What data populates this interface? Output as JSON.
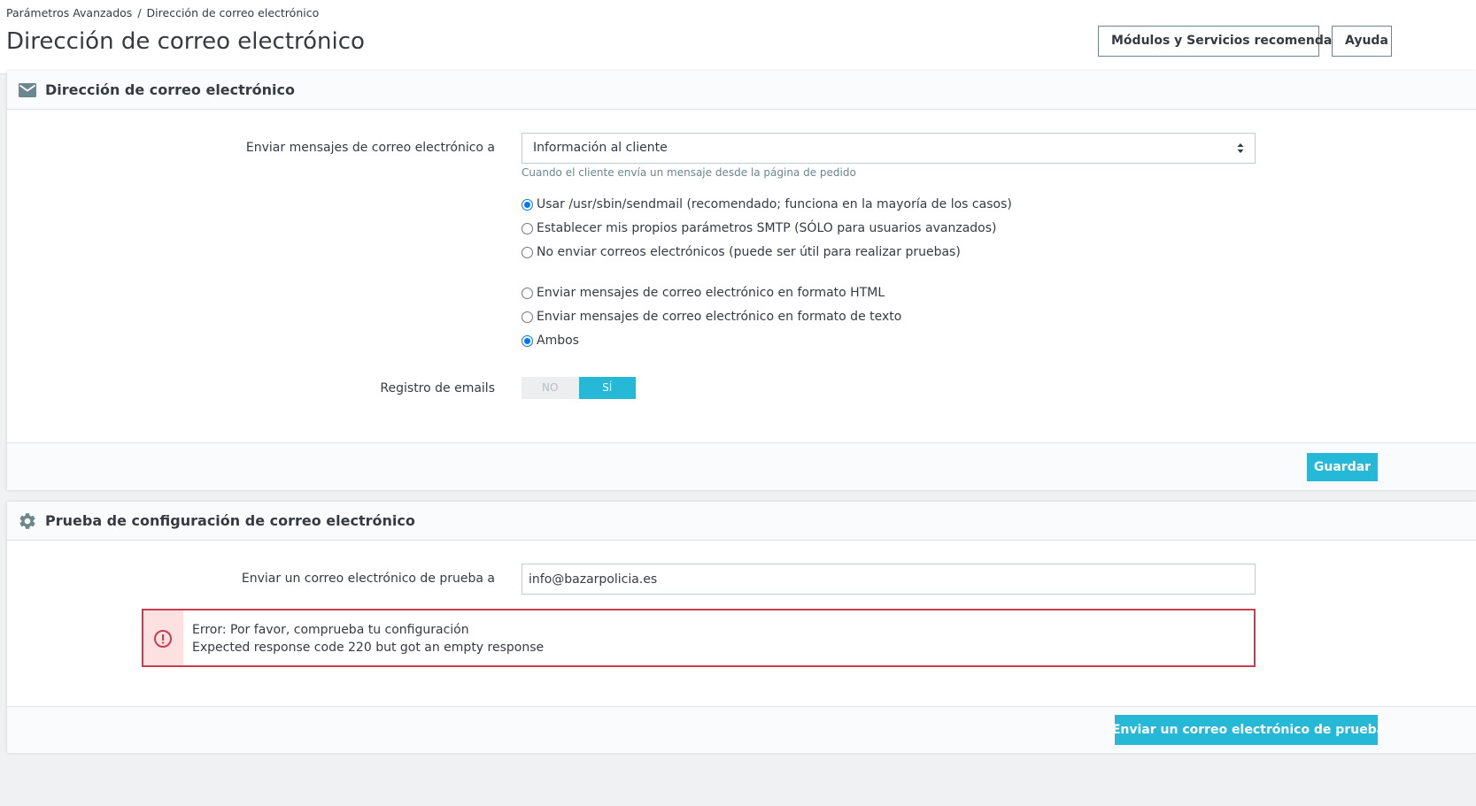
{
  "breadcrumb": {
    "parent": "Parámetros Avanzados",
    "separator": "/",
    "current": "Dirección de correo electrónico"
  },
  "page_title": "Dirección de correo electrónico",
  "header_buttons": {
    "modules": "Módulos y Servicios recomendados",
    "help": "Ayuda"
  },
  "email_panel": {
    "title": "Dirección de correo electrónico",
    "icon": "envelope-icon",
    "send_to_label": "Enviar mensajes de correo electrónico a",
    "send_to_value": "Información al cliente",
    "send_to_help": "Cuando el cliente envía un mensaje desde la página de pedido",
    "method_options": [
      {
        "label": "Usar /usr/sbin/sendmail (recomendado; funciona en la mayoría de los casos)",
        "checked": true
      },
      {
        "label": "Establecer mis propios parámetros SMTP (SÓLO para usuarios avanzados)",
        "checked": false
      },
      {
        "label": "No enviar correos electrónicos (puede ser útil para realizar pruebas)",
        "checked": false
      }
    ],
    "format_options": [
      {
        "label": "Enviar mensajes de correo electrónico en formato HTML",
        "checked": false
      },
      {
        "label": "Enviar mensajes de correo electrónico en formato de texto",
        "checked": false
      },
      {
        "label": "Ambos",
        "checked": true
      }
    ],
    "log_label": "Registro de emails",
    "log_switch": {
      "off": "NO",
      "on": "SÍ",
      "value": "on"
    },
    "save_label": "Guardar"
  },
  "test_panel": {
    "title": "Prueba de configuración de correo electrónico",
    "icon": "gear-icon",
    "test_to_label": "Enviar un correo electrónico de prueba a",
    "test_to_value": "info@bazarpolicia.es",
    "error_line1": "Error: Por favor, comprueba tu configuración",
    "error_line2": "Expected response code 220 but got an empty response",
    "send_test_label": "Enviar un correo electrónico de prueba"
  },
  "colors": {
    "primary": "#25b9d7",
    "danger": "#c63e4f",
    "danger_bg": "#fde1e1",
    "text": "#363a41",
    "muted": "#6c868e"
  }
}
